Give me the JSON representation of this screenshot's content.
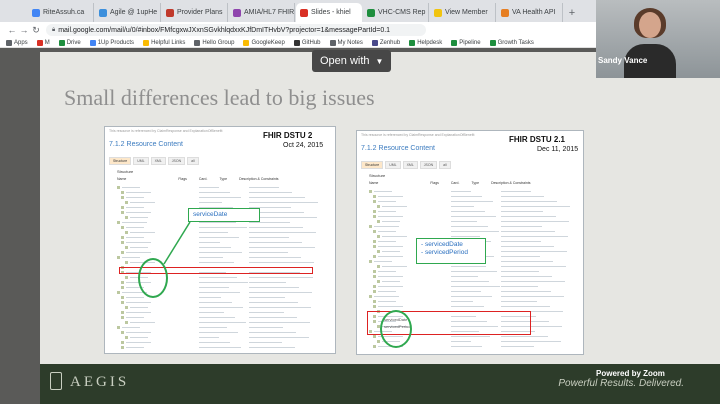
{
  "browser": {
    "tabs": [
      {
        "label": "RiteAssuh.ca",
        "color": "#4285f4"
      },
      {
        "label": "Agile @ 1upHe",
        "color": "#3c8fdc"
      },
      {
        "label": "Provider Plans",
        "color": "#c0392b"
      },
      {
        "label": "AMIA/HL7 FHIR",
        "color": "#8e44ad"
      },
      {
        "label": "Slides - khiel",
        "color": "#d93025"
      },
      {
        "label": "VHC-CMS Rep",
        "color": "#1e8e3e"
      },
      {
        "label": "View Member",
        "color": "#f1c40f"
      },
      {
        "label": "VA Health API",
        "color": "#e67e22"
      }
    ],
    "url": "mail.google.com/mail/u/0/#inbox/FMfcgxwJXxnSGvkhlqdxxKJfDmITHvbV?projector=1&messagePartId=0.1",
    "bookmarks": [
      {
        "label": "Apps",
        "color": "#5f6368"
      },
      {
        "label": "M",
        "color": "#d93025"
      },
      {
        "label": "Drive",
        "color": "#1e8e3e"
      },
      {
        "label": "1Up Products",
        "color": "#4285f4"
      },
      {
        "label": "Helpful Links",
        "color": "#fbbc04"
      },
      {
        "label": "Hello Group",
        "color": "#5f6368"
      },
      {
        "label": "GoogleKeep",
        "color": "#fbbc04"
      },
      {
        "label": "GitHub",
        "color": "#333333"
      },
      {
        "label": "My Notes",
        "color": "#5f6368"
      },
      {
        "label": "Zenhub",
        "color": "#4a4a8a"
      },
      {
        "label": "Helpdesk",
        "color": "#1e8e3e"
      },
      {
        "label": "Pipeline",
        "color": "#1e8e3e"
      },
      {
        "label": "Growth Tasks",
        "color": "#1e8e3e"
      }
    ]
  },
  "viewer": {
    "open_with": "Open with"
  },
  "slide": {
    "title": "Small differences lead to big issues",
    "left": {
      "label": "FHIR DSTU 2",
      "date": "Oct 24, 2015",
      "resource_content": "7.1.2 Resource Content",
      "header": "This resource is referenced by ClaimResponse and ExplanationOfBenefit",
      "tabs": [
        "Structure",
        "UML",
        "XML",
        "JSON",
        "all"
      ],
      "structure": "Structure",
      "columns": [
        "Name",
        "Flags",
        "Card.",
        "Type",
        "Description & Constraints"
      ],
      "annotation": "serviceDate"
    },
    "right": {
      "label": "FHIR DSTU 2.1",
      "date": "Dec 11, 2015",
      "resource_content": "7.1.2 Resource Content",
      "header": "This resource is referenced by ClaimResponse and ExplanationOfBenefit",
      "tabs": [
        "Structure",
        "UML",
        "XML",
        "JSON",
        "all"
      ],
      "structure": "Structure",
      "columns": [
        "Name",
        "Flags",
        "Card.",
        "Type",
        "Description & Constraints"
      ],
      "annotation_lines": [
        "- servicedDate",
        "- servicedPeriod"
      ],
      "fields": [
        "servicedDate",
        "servicedPeriod"
      ]
    },
    "footer": {
      "logo": "AEGIS",
      "tagline": "Powerful Results. Delivered."
    }
  },
  "webcam": {
    "name": "Sandy Vance"
  },
  "zoom_badge": "Powered by Zoom"
}
